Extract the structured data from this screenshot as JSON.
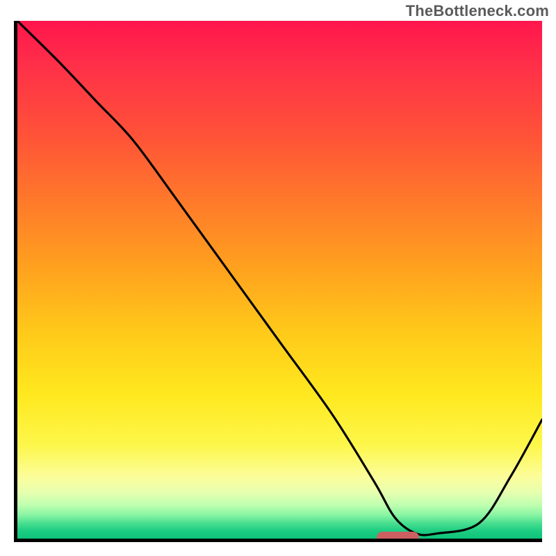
{
  "watermark": "TheBottleneck.com",
  "chart_data": {
    "type": "line",
    "title": "",
    "xlabel": "",
    "ylabel": "",
    "xlim": [
      0,
      100
    ],
    "ylim": [
      0,
      100
    ],
    "x": [
      0,
      8,
      15,
      22,
      30,
      40,
      50,
      60,
      68,
      72,
      76,
      80,
      88,
      94,
      100
    ],
    "values": [
      100,
      92,
      84.5,
      77,
      66,
      52,
      38,
      24,
      11,
      4,
      1,
      1,
      3,
      12,
      23
    ],
    "marker": {
      "x": 72,
      "y": 1,
      "width": 8
    },
    "colors": {
      "top": "#ff154c",
      "mid": "#ffe81e",
      "bottom": "#0ec37a",
      "curve": "#000000",
      "marker": "#cc5f62"
    }
  }
}
